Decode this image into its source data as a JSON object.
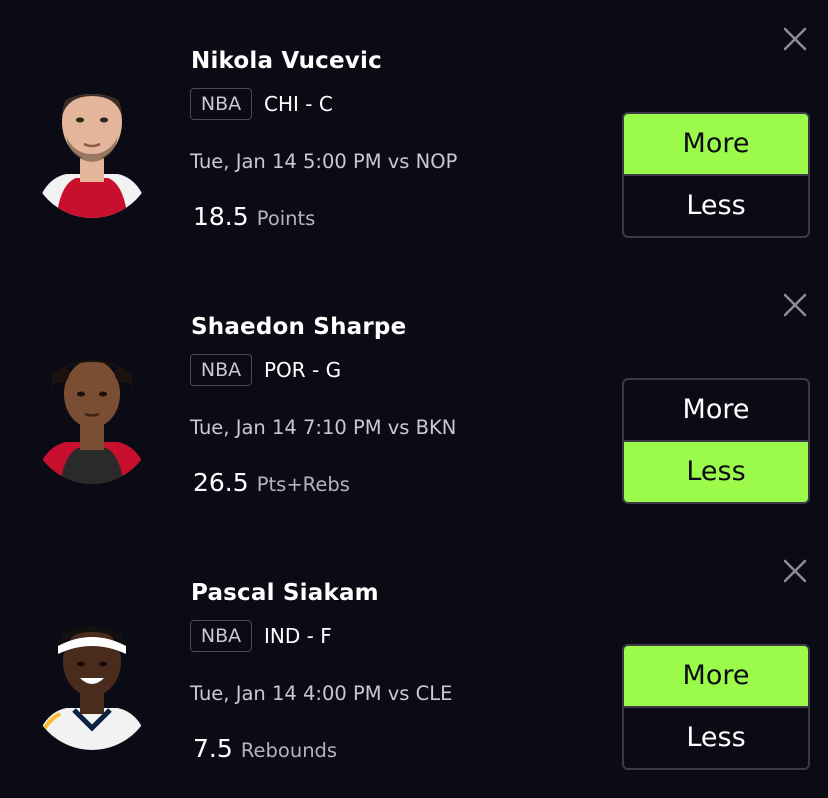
{
  "cards": [
    {
      "player_name": "Nikola Vucevic",
      "league": "NBA",
      "team_position": "CHI - C",
      "game_time": "Tue, Jan 14 5:00 PM vs NOP",
      "line_value": "18.5",
      "stat_label": "Points",
      "more_label": "More",
      "less_label": "Less",
      "selected": "more",
      "jersey_color": "#c8102e",
      "skin_color": "#e3b59a",
      "hair_color": "#3a2c24"
    },
    {
      "player_name": "Shaedon Sharpe",
      "league": "NBA",
      "team_position": "POR - G",
      "game_time": "Tue, Jan 14 7:10 PM vs BKN",
      "line_value": "26.5",
      "stat_label": "Pts+Rebs",
      "more_label": "More",
      "less_label": "Less",
      "selected": "less",
      "jersey_color": "#c8102e",
      "skin_color": "#7a4e33",
      "hair_color": "#1b120d"
    },
    {
      "player_name": "Pascal Siakam",
      "league": "NBA",
      "team_position": "IND - F",
      "game_time": "Tue, Jan 14 4:00 PM vs CLE",
      "line_value": "7.5",
      "stat_label": "Rebounds",
      "more_label": "More",
      "less_label": "Less",
      "selected": "more",
      "jersey_color": "#f2f2f2",
      "skin_color": "#4a2c1d",
      "hair_color": "#141010"
    }
  ],
  "colors": {
    "background": "#0b0b16",
    "selected_accent": "#9cfa4a",
    "divider": "#2c2c39"
  },
  "icons": {
    "close": "close-icon",
    "avatar": "player-headshot"
  }
}
